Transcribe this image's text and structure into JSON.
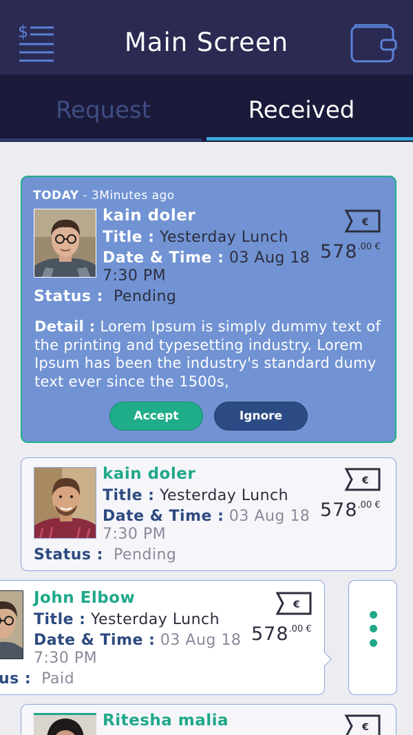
{
  "header": {
    "title": "Main Screen",
    "menu_icon": "dollar-list-icon",
    "wallet_icon": "wallet-icon"
  },
  "tabs": [
    {
      "label": "Request",
      "active": false
    },
    {
      "label": "Received",
      "active": true
    }
  ],
  "colors": {
    "header_bg": "#2b2a52",
    "tab_bg": "#1b1a3a",
    "tab_indicator": "#3aa7dc",
    "highlight_card": "#7193d3",
    "accent_teal": "#1fa88a",
    "label_navy": "#2d4a80"
  },
  "labels": {
    "title": "Title :",
    "date_time": "Date & Time :",
    "status": "Status :",
    "detail": "Detail :"
  },
  "cards": [
    {
      "timestamp_day": "TODAY",
      "timestamp_rest": " - 3Minutes ago",
      "name": "kain doler",
      "title": "Yesterday Lunch",
      "date": "03 Aug 18",
      "time": "7:30 PM",
      "status": "Pending",
      "amount": "578",
      "amount_decimals": ".00 €",
      "detail": "Lorem Ipsum is simply dummy text of the printing and typesetting industry. Lorem Ipsum has been the industry's standard dumy text ever since the 1500s,",
      "accept_label": "Accept",
      "ignore_label": "Ignore"
    },
    {
      "name": "kain doler",
      "title": "Yesterday Lunch",
      "date": "03 Aug 18",
      "time": "7:30 PM",
      "status": "Pending",
      "amount": "578",
      "amount_decimals": ".00 €"
    },
    {
      "name": "John Elbow",
      "title": "Yesterday Lunch",
      "date": "03 Aug 18",
      "time": "7:30 PM",
      "status_label_partial": "us :",
      "status": "Paid",
      "amount": "578",
      "amount_decimals": ".00 €"
    },
    {
      "name": "Ritesha malia"
    }
  ],
  "ticket_icon_glyph": "€"
}
